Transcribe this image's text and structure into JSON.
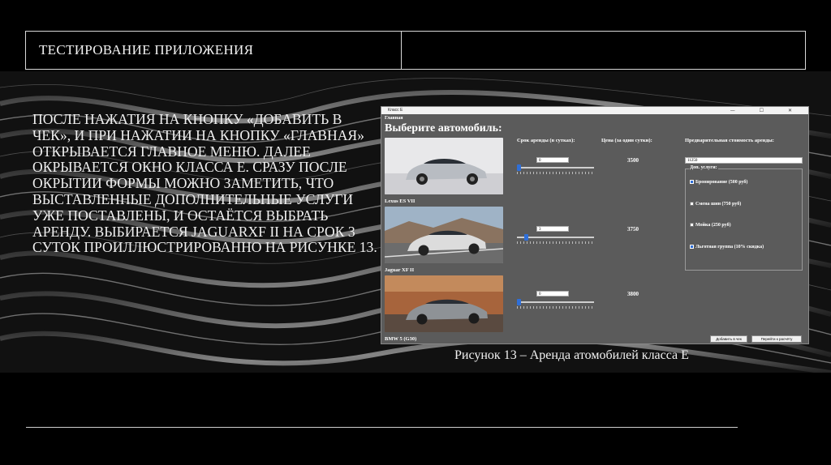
{
  "slide": {
    "title": "ТЕСТИРОВАНИЕ ПРИЛОЖЕНИЯ",
    "body": "После нажатия на кнопку «Добавить в чек», и при нажатии на кнопку «Главная» открывается главное меню. Далее окрывается окно класса Е. Сразу после окрытии формы можно заметить, что выставленные дополнительные услуги уже поставлены, и остаётся выбрать аренду. Выбирается JaguarXF II на срок 3 суток проиллюстрированно на рисунке 13.",
    "caption": "Рисунок 13 – Аренда атомобилей класса Е"
  },
  "app": {
    "window_title": "Класс Е",
    "menu": "Главная",
    "heading": "Выберите автомобиль:",
    "col_term": "Срок аренды (в сутках):",
    "col_price": "Цена (за один сутки):",
    "col_total": "Предварительная стоимость аренды:",
    "total_value": "11250",
    "cars": [
      {
        "name": "Lexus ES VII",
        "days": "0",
        "price": "3500",
        "slider": 0.0
      },
      {
        "name": "Jaguar XF II",
        "days": "3",
        "price": "3750",
        "slider": 0.1
      },
      {
        "name": "BMW 5 (G30)",
        "days": "0",
        "price": "3800",
        "slider": 0.0
      }
    ],
    "services_label": "Доп. услуги:",
    "services": [
      {
        "label": "Бронирование (500 руб)",
        "checked": true
      },
      {
        "label": "Смена шин (750 руб)",
        "checked": false
      },
      {
        "label": "Мойка (250 руб)",
        "checked": false
      },
      {
        "label": "Льготная группа (10% скидка)",
        "checked": true
      }
    ],
    "btn_add": "Добавить в чек",
    "btn_go": "Перейти к расчёту"
  },
  "colors": {
    "background": "#000000",
    "app_bg": "#5b5b5b",
    "accent": "#2f6fd8"
  }
}
